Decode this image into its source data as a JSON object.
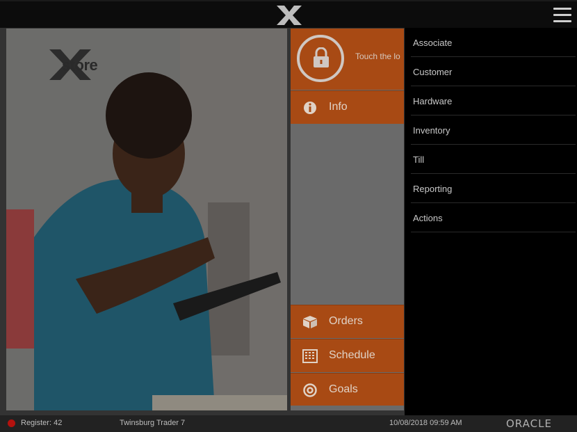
{
  "app": {
    "logo_icon": "xstore-x-logo-icon"
  },
  "welcome": {
    "brand_text": "store",
    "image": "associate-with-tablet-photo"
  },
  "tiles": {
    "lock": {
      "icon": "lock-icon",
      "text": "Touch the lo"
    },
    "info": {
      "icon": "info-icon",
      "label": "Info"
    },
    "orders": {
      "icon": "box-icon",
      "label": "Orders"
    },
    "schedule": {
      "icon": "calendar-grid-icon",
      "label": "Schedule"
    },
    "goals": {
      "icon": "target-icon",
      "label": "Goals"
    }
  },
  "menu": {
    "items": [
      {
        "label": "Associate"
      },
      {
        "label": "Customer"
      },
      {
        "label": "Hardware"
      },
      {
        "label": "Inventory"
      },
      {
        "label": "Till"
      },
      {
        "label": "Reporting"
      },
      {
        "label": "Actions"
      }
    ]
  },
  "status": {
    "register": "Register: 42",
    "store": "Twinsburg Trader 7",
    "datetime": "10/08/2018 09:59 AM",
    "vendor": "ORACLE",
    "indicator_color": "#b3120e"
  },
  "colors": {
    "accent": "#a84a14",
    "panel_bg": "#000000"
  }
}
